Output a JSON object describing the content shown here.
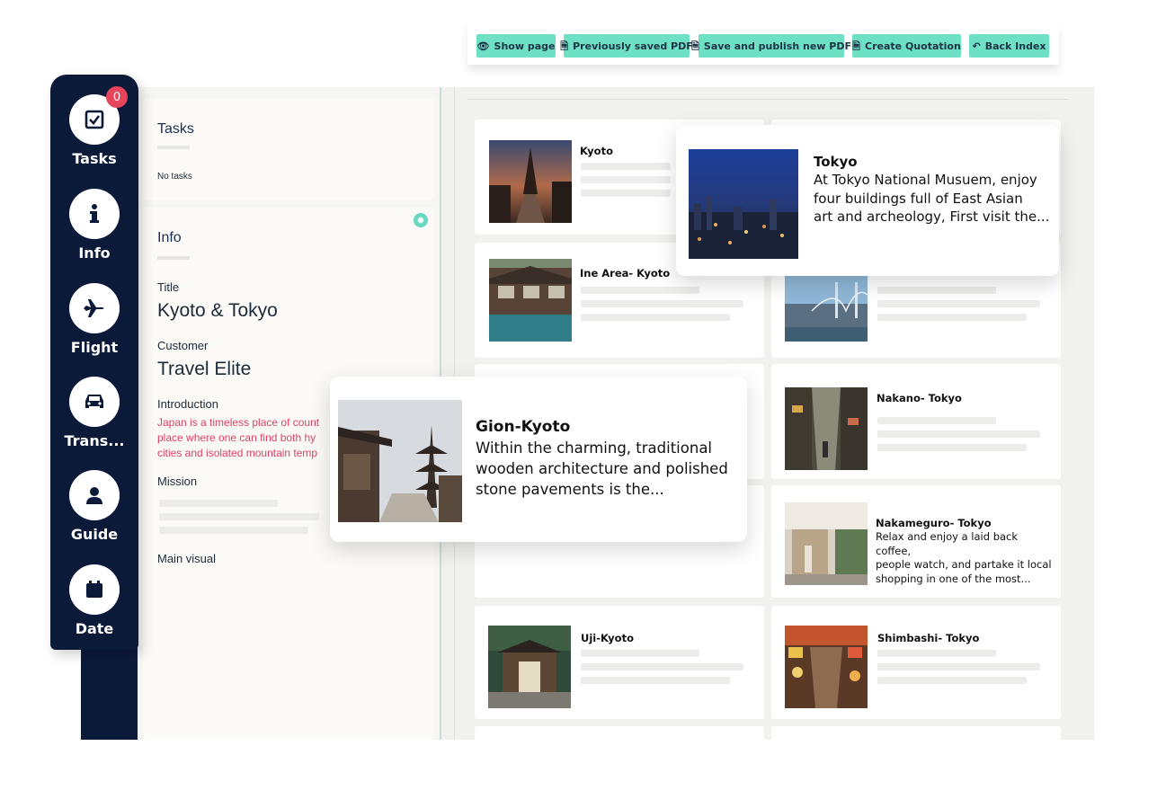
{
  "toolbar": {
    "show_page": "Show page",
    "previously_saved_pdf": "Previously saved PDF",
    "save_publish_pdf": "Save and publish new PDF",
    "create_quotation": "Create Quotation",
    "back_index": "Back Index"
  },
  "sidebar": {
    "badge_count": "0",
    "items": [
      {
        "label": "Tasks",
        "icon": "tasks-icon"
      },
      {
        "label": "Info",
        "icon": "info-icon"
      },
      {
        "label": "Flight",
        "icon": "plane-icon"
      },
      {
        "label": "Trans...",
        "icon": "car-icon"
      },
      {
        "label": "Guide",
        "icon": "person-icon"
      },
      {
        "label": "Date",
        "icon": "calendar-icon"
      }
    ]
  },
  "tasks_card": {
    "title": "Tasks",
    "empty_text": "No tasks"
  },
  "info_card": {
    "title": "Info",
    "title_label": "Title",
    "title_value": "Kyoto & Tokyo",
    "customer_label": "Customer",
    "customer_value": "Travel Elite",
    "introduction_label": "Introduction",
    "introduction_lines": [
      "Japan is a timeless place of count",
      "place where one can find both hy",
      "cities and isolated mountain temp"
    ],
    "mission_label": "Mission",
    "main_visual_label": "Main visual"
  },
  "destinations": {
    "kyoto": "Kyoto",
    "ine_area": "Ine Area- Kyoto",
    "nakano": "Nakano- Tokyo",
    "nakameguro": "Nakameguro- Tokyo",
    "nakameguro_desc": [
      "Relax and enjoy a laid back coffee,",
      "people watch, and partake it local",
      "shopping in one of the most..."
    ],
    "uji": "Uji-Kyoto",
    "shimbashi": "Shimbashi- Tokyo"
  },
  "popups": {
    "tokyo": {
      "title": "Tokyo",
      "lines": [
        "At Tokyo National Musuem, enjoy",
        "four buildings full of East Asian",
        "art and archeology, First visit the..."
      ]
    },
    "gion": {
      "title": "Gion-Kyoto",
      "lines": [
        "Within the charming, traditional",
        "wooden architecture and polished",
        "stone pavements is the..."
      ]
    }
  },
  "colors": {
    "sidebar_bg": "#0c1a3a",
    "button_bg": "#6ee0c4",
    "badge": "#e6455b",
    "intro_text": "#e04068"
  }
}
